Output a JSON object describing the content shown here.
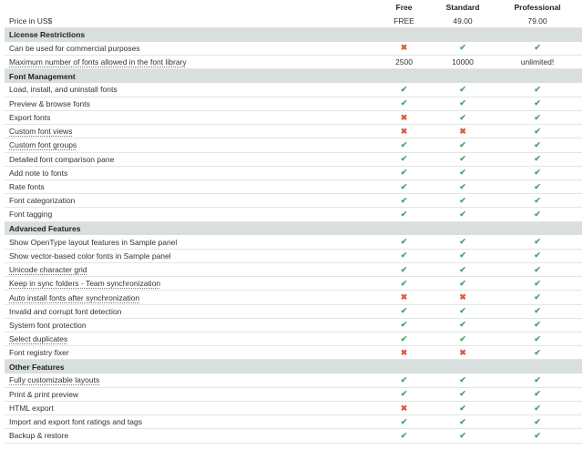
{
  "columns": {
    "free": "Free",
    "standard": "Standard",
    "professional": "Professional"
  },
  "price_row": {
    "label": "Price in US$",
    "free": "FREE",
    "standard": "49.00",
    "professional": "79.00"
  },
  "sections": [
    {
      "title": "License Restrictions",
      "rows": [
        {
          "label": "Can be used for commercial purposes",
          "link": false,
          "values": [
            "cross",
            "check",
            "check"
          ]
        },
        {
          "label": "Maximum number of fonts allowed in the font library",
          "link": true,
          "values": [
            "2500",
            "10000",
            "unlimited!"
          ]
        }
      ]
    },
    {
      "title": "Font Management",
      "rows": [
        {
          "label": "Load, install, and uninstall fonts",
          "link": false,
          "values": [
            "check",
            "check",
            "check"
          ]
        },
        {
          "label": "Preview & browse fonts",
          "link": false,
          "values": [
            "check",
            "check",
            "check"
          ]
        },
        {
          "label": "Export fonts",
          "link": false,
          "values": [
            "cross",
            "check",
            "check"
          ]
        },
        {
          "label": "Custom font views",
          "link": true,
          "values": [
            "cross",
            "cross",
            "check"
          ]
        },
        {
          "label": "Custom font groups",
          "link": true,
          "values": [
            "check",
            "check",
            "check"
          ]
        },
        {
          "label": "Detailed font comparison pane",
          "link": false,
          "values": [
            "check",
            "check",
            "check"
          ]
        },
        {
          "label": "Add note to fonts",
          "link": false,
          "values": [
            "check",
            "check",
            "check"
          ]
        },
        {
          "label": "Rate fonts",
          "link": false,
          "values": [
            "check",
            "check",
            "check"
          ]
        },
        {
          "label": "Font categorization",
          "link": false,
          "values": [
            "check",
            "check",
            "check"
          ]
        },
        {
          "label": "Font tagging",
          "link": false,
          "values": [
            "check",
            "check",
            "check"
          ]
        }
      ]
    },
    {
      "title": "Advanced Features",
      "rows": [
        {
          "label": "Show OpenType layout features in Sample panel",
          "link": false,
          "values": [
            "check",
            "check",
            "check"
          ]
        },
        {
          "label": "Show vector-based color fonts in Sample panel",
          "link": false,
          "values": [
            "check",
            "check",
            "check"
          ]
        },
        {
          "label": "Unicode character grid",
          "link": true,
          "values": [
            "check",
            "check",
            "check"
          ]
        },
        {
          "label": "Keep in sync folders - Team synchronization",
          "link": true,
          "values": [
            "check",
            "check",
            "check"
          ]
        },
        {
          "label": "Auto install fonts after synchronization",
          "link": true,
          "values": [
            "cross",
            "cross",
            "check"
          ]
        },
        {
          "label": "Invalid and corrupt font detection",
          "link": false,
          "values": [
            "check",
            "check",
            "check"
          ]
        },
        {
          "label": "System font protection",
          "link": false,
          "values": [
            "check",
            "check",
            "check"
          ]
        },
        {
          "label": "Select duplicates",
          "link": true,
          "values": [
            "check",
            "check",
            "check"
          ]
        },
        {
          "label": "Font registry fixer",
          "link": false,
          "values": [
            "cross",
            "cross",
            "check"
          ]
        }
      ]
    },
    {
      "title": "Other Features",
      "rows": [
        {
          "label": "Fully customizable layouts",
          "link": true,
          "values": [
            "check",
            "check",
            "check"
          ]
        },
        {
          "label": "Print & print preview",
          "link": false,
          "values": [
            "check",
            "check",
            "check"
          ]
        },
        {
          "label": "HTML export",
          "link": false,
          "values": [
            "cross",
            "check",
            "check"
          ]
        },
        {
          "label": "Import and export font ratings and tags",
          "link": false,
          "values": [
            "check",
            "check",
            "check"
          ]
        },
        {
          "label": "Backup & restore",
          "link": false,
          "values": [
            "check",
            "check",
            "check"
          ]
        }
      ]
    }
  ],
  "icons": {
    "check": "check-icon",
    "cross": "cross-icon"
  },
  "colors": {
    "check": "#4aa36a",
    "cross": "#e0573d",
    "section_bg": "#d9dede"
  }
}
